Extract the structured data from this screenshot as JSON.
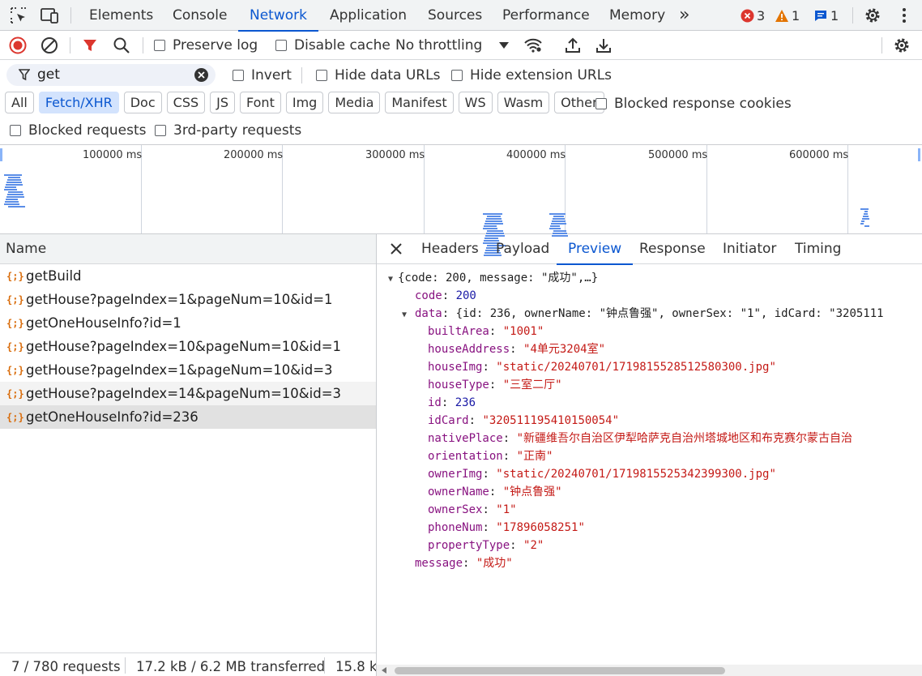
{
  "tabs": [
    "Elements",
    "Console",
    "Network",
    "Application",
    "Sources",
    "Performance",
    "Memory"
  ],
  "more_tabs": "»",
  "badges": {
    "errors": "3",
    "warnings": "1",
    "messages": "1"
  },
  "toolbar": {
    "preserve_log": "Preserve log",
    "disable_cache": "Disable cache",
    "throttling": "No throttling"
  },
  "filter": {
    "value": "get",
    "invert": "Invert",
    "hide_data_urls": "Hide data URLs",
    "hide_extension_urls": "Hide extension URLs"
  },
  "type_chips": [
    "All",
    "Fetch/XHR",
    "Doc",
    "CSS",
    "JS",
    "Font",
    "Img",
    "Media",
    "Manifest",
    "WS",
    "Wasm",
    "Other"
  ],
  "active_chip": "Fetch/XHR",
  "blocked_response_cookies": "Blocked response cookies",
  "blocked_requests": "Blocked requests",
  "third_party_requests": "3rd-party requests",
  "timeline_ticks": [
    "100000 ms",
    "200000 ms",
    "300000 ms",
    "400000 ms",
    "500000 ms",
    "600000 ms"
  ],
  "list_header": "Name",
  "requests": [
    "getBuild",
    "getHouse?pageIndex=1&pageNum=10&id=1",
    "getOneHouseInfo?id=1",
    "getHouse?pageIndex=10&pageNum=10&id=1",
    "getHouse?pageIndex=1&pageNum=10&id=3",
    "getHouse?pageIndex=14&pageNum=10&id=3",
    "getOneHouseInfo?id=236"
  ],
  "status": {
    "requests": "7 / 780 requests",
    "transferred": "17.2 kB / 6.2 MB transferred",
    "resources": "15.8 k"
  },
  "detail_tabs": [
    "Headers",
    "Payload",
    "Preview",
    "Response",
    "Initiator",
    "Timing"
  ],
  "active_detail_tab": "Preview",
  "preview": {
    "root_summary": "{code: 200, message: \"成功\",…}",
    "code_key": "code",
    "code_value": "200",
    "data_key": "data",
    "data_summary": "{id: 236, ownerName: \"钟点鲁强\", ownerSex: \"1\", idCard: \"3205111",
    "fields": [
      {
        "key": "builtArea",
        "value": "\"1001\"",
        "kind": "str"
      },
      {
        "key": "houseAddress",
        "value": "\"4单元3204室\"",
        "kind": "str"
      },
      {
        "key": "houseImg",
        "value": "\"static/20240701/1719815528512580300.jpg\"",
        "kind": "str"
      },
      {
        "key": "houseType",
        "value": "\"三室二厅\"",
        "kind": "str"
      },
      {
        "key": "id",
        "value": "236",
        "kind": "num"
      },
      {
        "key": "idCard",
        "value": "\"320511195410150054\"",
        "kind": "str"
      },
      {
        "key": "nativePlace",
        "value": "\"新疆维吾尔自治区伊犁哈萨克自治州塔城地区和布克赛尔蒙古自治",
        "kind": "str"
      },
      {
        "key": "orientation",
        "value": "\"正南\"",
        "kind": "str"
      },
      {
        "key": "ownerImg",
        "value": "\"static/20240701/1719815525342399300.jpg\"",
        "kind": "str"
      },
      {
        "key": "ownerName",
        "value": "\"钟点鲁强\"",
        "kind": "str"
      },
      {
        "key": "ownerSex",
        "value": "\"1\"",
        "kind": "str"
      },
      {
        "key": "phoneNum",
        "value": "\"17896058251\"",
        "kind": "str"
      },
      {
        "key": "propertyType",
        "value": "\"2\"",
        "kind": "str"
      }
    ],
    "message_key": "message",
    "message_value": "\"成功\""
  },
  "colors": {
    "accent": "#0b57d0",
    "error": "#dc362e",
    "warning": "#e37400",
    "record": "#dc362e"
  }
}
